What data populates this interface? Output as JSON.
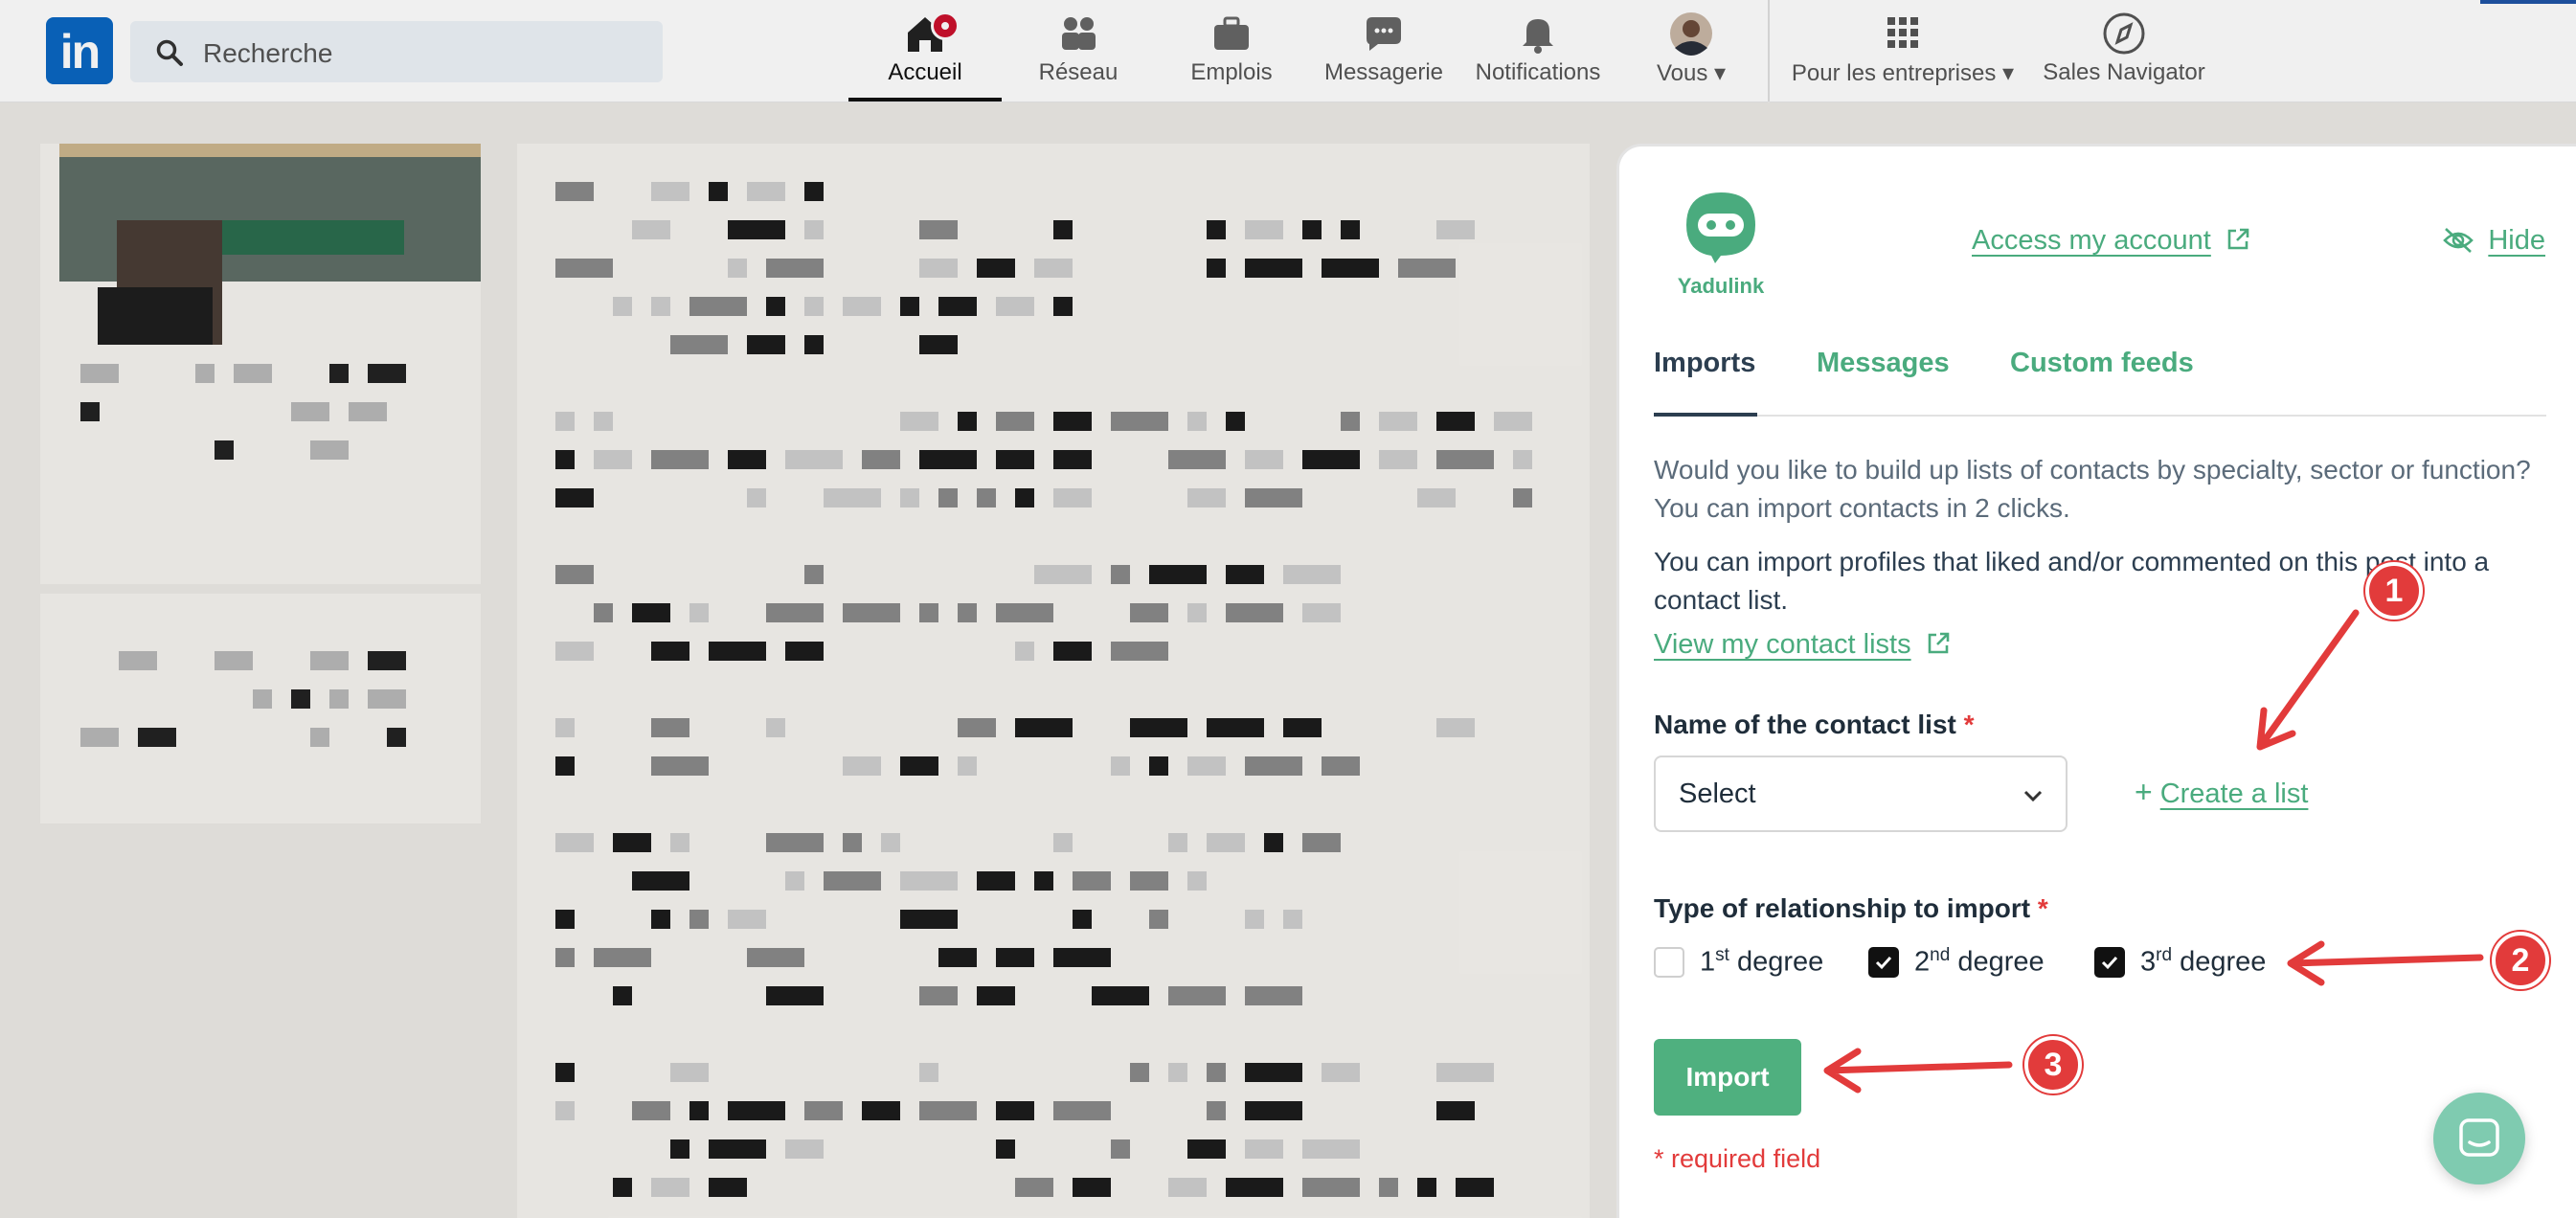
{
  "topbar": {
    "logo": "in",
    "search_placeholder": "Recherche",
    "nav": [
      {
        "label": "Accueil",
        "icon": "home-icon",
        "active": true
      },
      {
        "label": "Réseau",
        "icon": "network-icon"
      },
      {
        "label": "Emplois",
        "icon": "briefcase-icon"
      },
      {
        "label": "Messagerie",
        "icon": "messaging-icon"
      },
      {
        "label": "Notifications",
        "icon": "bell-icon"
      },
      {
        "label": "Vous",
        "icon": "avatar"
      },
      {
        "label": "Pour les entreprises",
        "icon": "grid-icon"
      },
      {
        "label": "Sales Navigator",
        "icon": "compass-icon"
      }
    ]
  },
  "panel": {
    "brand": "Yadulink",
    "access_account": "Access my account",
    "hide": "Hide",
    "tabs": [
      {
        "label": "Imports",
        "active": true
      },
      {
        "label": "Messages"
      },
      {
        "label": "Custom feeds"
      }
    ],
    "intro": "Would you like to build up lists of contacts by specialty, sector or function? You can import contacts in 2 clicks.",
    "import_info": "You can import profiles that liked and/or commented on this post into a contact list.",
    "view_lists": "View my contact lists",
    "list_name_label": "Name of the contact list",
    "required_mark": "*",
    "select_value": "Select",
    "create_list": "Create a list",
    "relationship_label": "Type of relationship to import",
    "degrees": [
      {
        "num": "1",
        "sup": "st",
        "word": "degree",
        "checked": false
      },
      {
        "num": "2",
        "sup": "nd",
        "word": "degree",
        "checked": true
      },
      {
        "num": "3",
        "sup": "rd",
        "word": "degree",
        "checked": true
      }
    ],
    "import_button": "Import",
    "required_note": "* required field"
  },
  "annotations": {
    "steps": [
      "1",
      "2",
      "3"
    ],
    "color": "#e23b3b"
  },
  "colors": {
    "brand_green": "#4aab7e",
    "linkedin_blue": "#0a66c2",
    "text_dark": "#2c3e50"
  }
}
